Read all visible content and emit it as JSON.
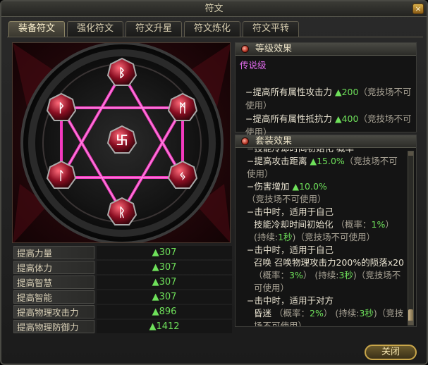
{
  "window": {
    "title": "符文",
    "close_symbol": "×"
  },
  "tabs": [
    {
      "label": "装备符文",
      "active": true
    },
    {
      "label": "强化符文",
      "active": false
    },
    {
      "label": "符文升星",
      "active": false
    },
    {
      "label": "符文炼化",
      "active": false
    },
    {
      "label": "符文平转",
      "active": false
    }
  ],
  "runes": {
    "center": "卐",
    "top": "ᛒ",
    "upper_left": "ᚹ",
    "upper_right": "ᛗ",
    "lower_left": "ᛚ",
    "lower_right": "ᛃ",
    "bottom": "ᚱ"
  },
  "stats": [
    {
      "label": "提高力量",
      "value": "▲307"
    },
    {
      "label": "提高体力",
      "value": "▲307"
    },
    {
      "label": "提高智慧",
      "value": "▲307"
    },
    {
      "label": "提高智能",
      "value": "▲307"
    },
    {
      "label": "提高物理攻击力",
      "value": "▲896"
    },
    {
      "label": "提高物理防御力",
      "value": "▲1412"
    }
  ],
  "level_effect": {
    "title": "等级效果",
    "grade": "传说级",
    "lines": [
      {
        "prefix": "−提高所有属性攻击力 ",
        "value": "▲200",
        "suffix": "（竞技场不可使用）"
      },
      {
        "prefix": "−提高所有属性抵抗力 ",
        "value": "▲400",
        "suffix": "（竞技场不可使用）"
      }
    ]
  },
  "set_effect": {
    "title": "套装效果",
    "cut_line": "−技能冷却时间初始化 概率",
    "lines": [
      {
        "prefix": "−提高攻击距离 ",
        "value": "▲15.0%",
        "suffix": "（竞技场不可使用）"
      },
      {
        "prefix": "−伤害增加 ",
        "value": "▲10.0%",
        "suffix": "（竞技场不可使用）"
      }
    ],
    "trigger1": {
      "head": "−击中时，适用于自己",
      "body": "技能冷却时间初始化",
      "rate_label": "（概率：",
      "rate": "1%",
      "rate_close": "）",
      "duration_label": "(持续:",
      "duration": "1秒",
      "duration_close": ")",
      "note": "（竞技场不可使用）"
    },
    "trigger2": {
      "head": "−击中时，适用于自己",
      "body": "召唤 召唤物理攻击力200%的陨落x20",
      "rate_label": "（概率：",
      "rate": "3%",
      "rate_close": "）",
      "duration_label": "(持续:",
      "duration": "3秒",
      "duration_close": ")",
      "note": "（竞技场不可使用）"
    },
    "trigger3": {
      "head": "−击中时，适用于对方",
      "body": "昏迷",
      "rate_label": "（概率：",
      "rate": "2%",
      "rate_close": "）",
      "duration_label": "(持续:",
      "duration": "3秒",
      "duration_close": ")",
      "note": "（竞技场不可使用）"
    }
  },
  "footer": {
    "close_label": "关闭"
  }
}
